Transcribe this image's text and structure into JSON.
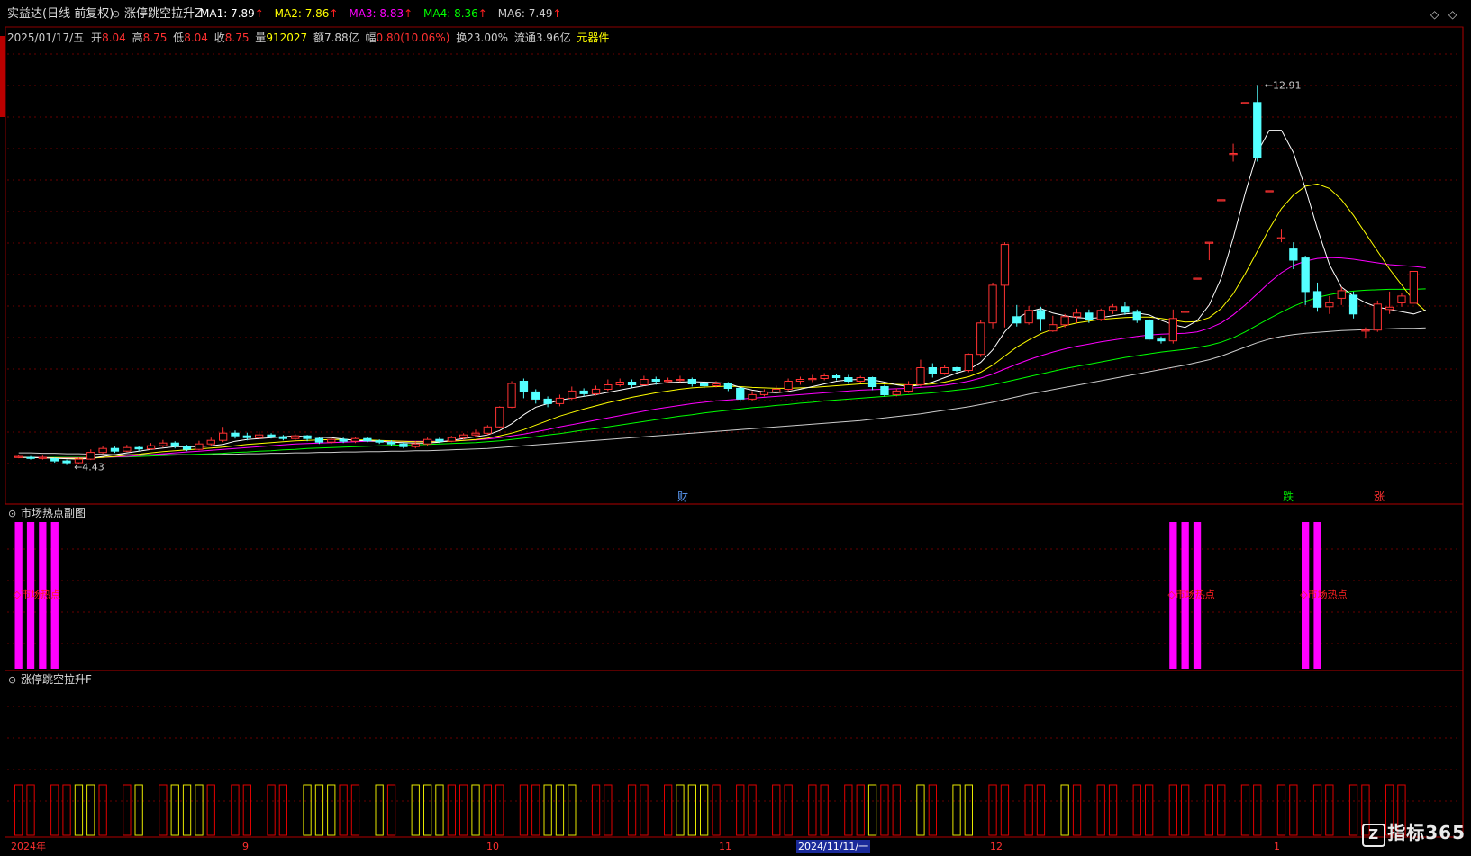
{
  "header": {
    "stock_name": "实益达",
    "period": "(日线 前复权)",
    "indicator_name": "涨停跳空拉升Z",
    "ma": [
      {
        "label": "MA1: 7.89",
        "arrow": "↑",
        "color": "#ffffff"
      },
      {
        "label": "MA2: 7.86",
        "arrow": "↑",
        "color": "#ffff00"
      },
      {
        "label": "MA3: 8.83",
        "arrow": "↑",
        "color": "#ff00ff"
      },
      {
        "label": "MA4: 8.36",
        "arrow": "↑",
        "color": "#00ff00"
      },
      {
        "label": "MA6: 7.49",
        "arrow": "↑",
        "color": "#cccccc"
      }
    ]
  },
  "info": {
    "date": "2025/01/17/五",
    "open_label": "开",
    "open": "8.04",
    "high_label": "高",
    "high": "8.75",
    "low_label": "低",
    "low": "8.04",
    "close_label": "收",
    "close": "8.75",
    "vol_label": "量",
    "vol": "912027",
    "amount_label": "额",
    "amount": "7.88亿",
    "change_label": "幅",
    "change": "0.80(10.06%)",
    "turnover_label": "换",
    "turnover": "23.00%",
    "float_label": "流通",
    "float": "3.96亿",
    "sector": "元器件"
  },
  "price_labels": {
    "high": "12.91",
    "low": "4.43"
  },
  "event_markers": [
    {
      "text": "财",
      "color": "#5fa0ff"
    },
    {
      "text": "跌",
      "color": "#00e000"
    },
    {
      "text": "涨",
      "color": "#ff3030"
    }
  ],
  "panels": {
    "hot": {
      "title": "市场热点副图",
      "signal_text": "市场热点"
    },
    "gap": {
      "title": "涨停跳空拉升F"
    }
  },
  "axis": {
    "dates": [
      {
        "text": "2024年",
        "highlight": false
      },
      {
        "text": "9",
        "highlight": false
      },
      {
        "text": "10",
        "highlight": false
      },
      {
        "text": "11",
        "highlight": false
      },
      {
        "text": "2024/11/11/一",
        "highlight": true
      },
      {
        "text": "12",
        "highlight": false
      },
      {
        "text": "1",
        "highlight": false
      }
    ]
  },
  "watermark": "指标365",
  "colors": {
    "up": "#ff3232",
    "down": "#54ffff",
    "grid": "#8b0000",
    "hot_bar": "#ff00ff",
    "gap_red": "#e00000",
    "gap_yellow": "#e8e800",
    "gap_blue": "#2020ff"
  },
  "chart_data": {
    "type": "candlestick",
    "candles": [
      [
        4.61,
        4.62,
        4.58,
        4.65
      ],
      [
        4.6,
        4.58,
        4.55,
        4.63
      ],
      [
        4.58,
        4.6,
        4.55,
        4.64
      ],
      [
        4.57,
        4.52,
        4.48,
        4.6
      ],
      [
        4.52,
        4.48,
        4.43,
        4.55
      ],
      [
        4.48,
        4.56,
        4.45,
        4.6
      ],
      [
        4.56,
        4.71,
        4.54,
        4.78
      ],
      [
        4.71,
        4.8,
        4.68,
        4.86
      ],
      [
        4.8,
        4.74,
        4.7,
        4.84
      ],
      [
        4.74,
        4.82,
        4.72,
        4.88
      ],
      [
        4.82,
        4.79,
        4.74,
        4.86
      ],
      [
        4.79,
        4.86,
        4.77,
        4.92
      ],
      [
        4.86,
        4.92,
        4.82,
        4.99
      ],
      [
        4.92,
        4.85,
        4.8,
        4.96
      ],
      [
        4.85,
        4.78,
        4.74,
        4.88
      ],
      [
        4.78,
        4.9,
        4.76,
        4.97
      ],
      [
        4.9,
        4.98,
        4.86,
        5.04
      ],
      [
        4.98,
        5.14,
        4.94,
        5.28
      ],
      [
        5.14,
        5.08,
        5.02,
        5.2
      ],
      [
        5.08,
        5.04,
        4.98,
        5.15
      ],
      [
        5.04,
        5.1,
        5.0,
        5.18
      ],
      [
        5.1,
        5.06,
        5.02,
        5.14
      ],
      [
        5.06,
        5.02,
        4.98,
        5.1
      ],
      [
        5.02,
        5.08,
        4.98,
        5.12
      ],
      [
        5.08,
        5.02,
        4.96,
        5.1
      ],
      [
        5.02,
        4.94,
        4.9,
        5.06
      ],
      [
        4.94,
        5.0,
        4.9,
        5.04
      ],
      [
        5.0,
        4.96,
        4.92,
        5.04
      ],
      [
        4.96,
        5.02,
        4.92,
        5.06
      ],
      [
        5.02,
        4.97,
        4.94,
        5.06
      ],
      [
        4.97,
        4.94,
        4.9,
        5.0
      ],
      [
        4.94,
        4.9,
        4.86,
        4.98
      ],
      [
        4.9,
        4.84,
        4.8,
        4.94
      ],
      [
        4.84,
        4.9,
        4.8,
        4.96
      ],
      [
        4.9,
        5.0,
        4.86,
        5.04
      ],
      [
        5.0,
        4.96,
        4.92,
        5.04
      ],
      [
        4.96,
        5.04,
        4.94,
        5.08
      ],
      [
        5.04,
        5.1,
        5.0,
        5.14
      ],
      [
        5.1,
        5.14,
        5.06,
        5.22
      ],
      [
        5.14,
        5.28,
        5.1,
        5.32
      ],
      [
        5.28,
        5.72,
        5.26,
        5.74
      ],
      [
        5.72,
        6.25,
        5.7,
        6.3
      ],
      [
        6.3,
        6.06,
        5.92,
        6.36
      ],
      [
        6.06,
        5.9,
        5.8,
        6.12
      ],
      [
        5.9,
        5.8,
        5.72,
        5.96
      ],
      [
        5.8,
        5.92,
        5.74,
        6.0
      ],
      [
        5.92,
        6.08,
        5.88,
        6.18
      ],
      [
        6.08,
        6.02,
        5.96,
        6.14
      ],
      [
        6.02,
        6.12,
        5.98,
        6.2
      ],
      [
        6.12,
        6.22,
        6.08,
        6.34
      ],
      [
        6.22,
        6.28,
        6.18,
        6.36
      ],
      [
        6.28,
        6.22,
        6.16,
        6.34
      ],
      [
        6.22,
        6.34,
        6.2,
        6.42
      ],
      [
        6.34,
        6.3,
        6.22,
        6.4
      ],
      [
        6.3,
        6.32,
        6.26,
        6.38
      ],
      [
        6.32,
        6.34,
        6.28,
        6.42
      ],
      [
        6.34,
        6.24,
        6.18,
        6.38
      ],
      [
        6.24,
        6.2,
        6.14,
        6.3
      ],
      [
        6.2,
        6.24,
        6.16,
        6.3
      ],
      [
        6.24,
        6.14,
        6.08,
        6.28
      ],
      [
        6.14,
        5.9,
        5.84,
        6.18
      ],
      [
        5.9,
        6.0,
        5.86,
        6.08
      ],
      [
        6.0,
        6.06,
        5.96,
        6.12
      ],
      [
        6.06,
        6.12,
        6.02,
        6.2
      ],
      [
        6.12,
        6.3,
        6.08,
        6.36
      ],
      [
        6.3,
        6.34,
        6.22,
        6.4
      ],
      [
        6.34,
        6.36,
        6.28,
        6.44
      ],
      [
        6.36,
        6.42,
        6.32,
        6.48
      ],
      [
        6.42,
        6.38,
        6.32,
        6.46
      ],
      [
        6.38,
        6.3,
        6.24,
        6.44
      ],
      [
        6.3,
        6.38,
        6.26,
        6.42
      ],
      [
        6.38,
        6.18,
        6.1,
        6.4
      ],
      [
        6.18,
        6.0,
        5.96,
        6.22
      ],
      [
        6.0,
        6.08,
        5.96,
        6.14
      ],
      [
        6.08,
        6.22,
        6.04,
        6.3
      ],
      [
        6.22,
        6.6,
        6.18,
        6.78
      ],
      [
        6.6,
        6.48,
        6.38,
        6.7
      ],
      [
        6.48,
        6.6,
        6.44,
        6.66
      ],
      [
        6.6,
        6.54,
        6.5,
        6.62
      ],
      [
        6.54,
        6.9,
        6.5,
        6.92
      ],
      [
        6.9,
        7.6,
        6.84,
        7.66
      ],
      [
        7.6,
        8.44,
        7.48,
        8.5
      ],
      [
        8.44,
        9.35,
        7.5,
        9.4
      ],
      [
        7.74,
        7.6,
        7.52,
        8.0
      ],
      [
        7.6,
        7.88,
        7.56,
        7.98
      ],
      [
        7.88,
        7.7,
        7.42,
        7.96
      ],
      [
        7.42,
        7.56,
        7.4,
        7.76
      ],
      [
        7.56,
        7.74,
        7.5,
        7.8
      ],
      [
        7.74,
        7.82,
        7.6,
        7.92
      ],
      [
        7.82,
        7.68,
        7.6,
        7.9
      ],
      [
        7.68,
        7.88,
        7.64,
        7.92
      ],
      [
        7.88,
        7.96,
        7.8,
        8.02
      ],
      [
        7.96,
        7.84,
        7.78,
        8.06
      ],
      [
        7.84,
        7.66,
        7.6,
        7.9
      ],
      [
        7.66,
        7.24,
        7.2,
        7.7
      ],
      [
        7.24,
        7.2,
        7.14,
        7.3
      ],
      [
        7.2,
        7.7,
        7.14,
        7.9
      ],
      [
        7.86,
        7.86,
        7.86,
        7.86
      ],
      [
        8.6,
        8.6,
        8.6,
        8.6
      ],
      [
        9.4,
        9.4,
        9.0,
        9.4
      ],
      [
        10.35,
        10.35,
        10.35,
        10.35
      ],
      [
        11.38,
        11.38,
        11.2,
        11.6
      ],
      [
        12.52,
        12.52,
        12.52,
        12.52
      ],
      [
        12.52,
        11.3,
        11.2,
        12.91
      ],
      [
        10.55,
        10.55,
        10.55,
        10.55
      ],
      [
        9.5,
        9.5,
        9.4,
        9.7
      ],
      [
        9.25,
        9.0,
        8.8,
        9.4
      ],
      [
        9.05,
        8.3,
        8.0,
        9.1
      ],
      [
        8.3,
        7.95,
        7.85,
        8.5
      ],
      [
        7.96,
        8.05,
        7.8,
        8.2
      ],
      [
        8.15,
        8.32,
        8.0,
        8.4
      ],
      [
        8.22,
        7.8,
        7.7,
        8.3
      ],
      [
        7.42,
        7.44,
        7.25,
        7.5
      ],
      [
        7.44,
        8.02,
        7.4,
        8.1
      ],
      [
        7.9,
        7.95,
        7.8,
        8.3
      ],
      [
        8.05,
        8.2,
        7.96,
        8.26
      ],
      [
        8.04,
        8.75,
        8.04,
        8.75
      ]
    ],
    "ma1": [
      4.6,
      4.6,
      4.59,
      4.58,
      4.57,
      4.56,
      4.58,
      4.62,
      4.66,
      4.7,
      4.74,
      4.78,
      4.81,
      4.84,
      4.84,
      4.84,
      4.86,
      4.89,
      4.96,
      5.0,
      5.02,
      5.04,
      5.06,
      5.08,
      5.06,
      5.05,
      5.04,
      5.01,
      4.98,
      4.97,
      4.96,
      4.94,
      4.93,
      4.92,
      4.92,
      4.94,
      4.98,
      5.02,
      5.06,
      5.1,
      5.2,
      5.35,
      5.55,
      5.72,
      5.8,
      5.88,
      5.92,
      5.96,
      6.0,
      6.05,
      6.1,
      6.15,
      6.2,
      6.24,
      6.27,
      6.28,
      6.29,
      6.28,
      6.27,
      6.25,
      6.16,
      6.1,
      6.06,
      6.04,
      6.07,
      6.12,
      6.18,
      6.24,
      6.3,
      6.33,
      6.34,
      6.33,
      6.28,
      6.22,
      6.18,
      6.22,
      6.28,
      6.38,
      6.48,
      6.56,
      6.72,
      7.0,
      7.4,
      7.7,
      7.85,
      7.92,
      7.82,
      7.76,
      7.72,
      7.7,
      7.72,
      7.76,
      7.8,
      7.82,
      7.78,
      7.66,
      7.56,
      7.5,
      7.65,
      8.0,
      8.6,
      9.5,
      10.5,
      11.4,
      11.9,
      11.9,
      11.4,
      10.6,
      9.7,
      8.9,
      8.4,
      8.2,
      8.05,
      7.95,
      7.9,
      7.85,
      7.8,
      7.89
    ],
    "ma2": [
      4.6,
      4.6,
      4.59,
      4.59,
      4.58,
      4.58,
      4.58,
      4.6,
      4.62,
      4.65,
      4.67,
      4.7,
      4.73,
      4.75,
      4.77,
      4.79,
      4.81,
      4.83,
      4.86,
      4.89,
      4.91,
      4.93,
      4.95,
      4.97,
      4.98,
      4.99,
      5.0,
      5.0,
      4.99,
      4.99,
      4.98,
      4.97,
      4.96,
      4.95,
      4.95,
      4.95,
      4.96,
      4.98,
      5.0,
      5.03,
      5.08,
      5.14,
      5.22,
      5.32,
      5.42,
      5.52,
      5.6,
      5.68,
      5.75,
      5.82,
      5.88,
      5.94,
      5.99,
      6.04,
      6.08,
      6.12,
      6.15,
      6.17,
      6.18,
      6.19,
      6.18,
      6.16,
      6.15,
      6.14,
      6.14,
      6.15,
      6.16,
      6.18,
      6.2,
      6.22,
      6.24,
      6.25,
      6.24,
      6.23,
      6.22,
      6.22,
      6.24,
      6.28,
      6.34,
      6.4,
      6.5,
      6.66,
      6.86,
      7.06,
      7.22,
      7.36,
      7.46,
      7.54,
      7.6,
      7.64,
      7.68,
      7.7,
      7.72,
      7.73,
      7.73,
      7.7,
      7.66,
      7.62,
      7.63,
      7.72,
      7.92,
      8.25,
      8.7,
      9.2,
      9.7,
      10.15,
      10.45,
      10.65,
      10.7,
      10.6,
      10.35,
      10.0,
      9.6,
      9.2,
      8.8,
      8.45,
      8.1,
      7.86
    ],
    "ma3": [
      4.6,
      4.6,
      4.6,
      4.59,
      4.59,
      4.59,
      4.59,
      4.6,
      4.61,
      4.62,
      4.64,
      4.66,
      4.68,
      4.7,
      4.72,
      4.74,
      4.76,
      4.78,
      4.8,
      4.82,
      4.84,
      4.86,
      4.88,
      4.9,
      4.91,
      4.92,
      4.93,
      4.94,
      4.95,
      4.96,
      4.96,
      4.96,
      4.96,
      4.96,
      4.96,
      4.96,
      4.97,
      4.98,
      4.99,
      5.01,
      5.04,
      5.08,
      5.12,
      5.17,
      5.22,
      5.28,
      5.33,
      5.38,
      5.43,
      5.48,
      5.53,
      5.58,
      5.63,
      5.68,
      5.72,
      5.76,
      5.8,
      5.83,
      5.86,
      5.88,
      5.9,
      5.92,
      5.94,
      5.96,
      5.98,
      6.0,
      6.02,
      6.04,
      6.06,
      6.08,
      6.1,
      6.11,
      6.12,
      6.13,
      6.14,
      6.16,
      6.18,
      6.21,
      6.25,
      6.3,
      6.37,
      6.46,
      6.57,
      6.68,
      6.78,
      6.87,
      6.95,
      7.02,
      7.08,
      7.13,
      7.18,
      7.22,
      7.26,
      7.3,
      7.33,
      7.35,
      7.36,
      7.37,
      7.4,
      7.48,
      7.6,
      7.78,
      8.0,
      8.25,
      8.5,
      8.72,
      8.88,
      8.98,
      9.04,
      9.06,
      9.05,
      9.02,
      8.98,
      8.94,
      8.9,
      8.88,
      8.86,
      8.83
    ],
    "ma4": [
      4.6,
      4.6,
      4.6,
      4.6,
      4.6,
      4.6,
      4.6,
      4.6,
      4.61,
      4.61,
      4.62,
      4.63,
      4.64,
      4.65,
      4.66,
      4.67,
      4.68,
      4.69,
      4.71,
      4.72,
      4.74,
      4.75,
      4.77,
      4.78,
      4.8,
      4.81,
      4.82,
      4.83,
      4.84,
      4.85,
      4.86,
      4.87,
      4.88,
      4.88,
      4.89,
      4.9,
      4.91,
      4.92,
      4.93,
      4.95,
      4.97,
      5.0,
      5.03,
      5.06,
      5.1,
      5.13,
      5.17,
      5.21,
      5.24,
      5.28,
      5.32,
      5.36,
      5.4,
      5.44,
      5.48,
      5.52,
      5.55,
      5.59,
      5.62,
      5.65,
      5.68,
      5.71,
      5.73,
      5.76,
      5.78,
      5.81,
      5.83,
      5.86,
      5.88,
      5.9,
      5.92,
      5.94,
      5.96,
      5.98,
      6.0,
      6.02,
      6.04,
      6.07,
      6.1,
      6.13,
      6.17,
      6.22,
      6.28,
      6.34,
      6.4,
      6.46,
      6.52,
      6.58,
      6.63,
      6.68,
      6.73,
      6.78,
      6.83,
      6.87,
      6.91,
      6.95,
      6.98,
      7.01,
      7.05,
      7.1,
      7.17,
      7.27,
      7.4,
      7.55,
      7.7,
      7.84,
      7.97,
      8.08,
      8.17,
      8.23,
      8.28,
      8.31,
      8.33,
      8.34,
      8.35,
      8.35,
      8.35,
      8.36
    ],
    "ma6": [
      4.7,
      4.7,
      4.69,
      4.69,
      4.68,
      4.68,
      4.67,
      4.67,
      4.66,
      4.66,
      4.66,
      4.66,
      4.66,
      4.66,
      4.66,
      4.66,
      4.66,
      4.67,
      4.67,
      4.68,
      4.68,
      4.69,
      4.69,
      4.7,
      4.7,
      4.71,
      4.71,
      4.72,
      4.72,
      4.73,
      4.73,
      4.74,
      4.74,
      4.75,
      4.75,
      4.76,
      4.77,
      4.78,
      4.79,
      4.8,
      4.82,
      4.84,
      4.86,
      4.88,
      4.9,
      4.92,
      4.94,
      4.96,
      4.98,
      5.0,
      5.02,
      5.04,
      5.06,
      5.08,
      5.1,
      5.12,
      5.14,
      5.16,
      5.18,
      5.2,
      5.22,
      5.24,
      5.26,
      5.28,
      5.3,
      5.32,
      5.34,
      5.36,
      5.38,
      5.4,
      5.42,
      5.45,
      5.48,
      5.51,
      5.54,
      5.57,
      5.61,
      5.65,
      5.69,
      5.73,
      5.78,
      5.83,
      5.89,
      5.95,
      6.01,
      6.06,
      6.11,
      6.16,
      6.21,
      6.26,
      6.31,
      6.36,
      6.41,
      6.46,
      6.51,
      6.56,
      6.61,
      6.66,
      6.72,
      6.78,
      6.86,
      6.96,
      7.06,
      7.16,
      7.24,
      7.3,
      7.34,
      7.37,
      7.39,
      7.41,
      7.43,
      7.44,
      7.45,
      7.46,
      7.47,
      7.48,
      7.48,
      7.49
    ],
    "y_range": [
      4.0,
      13.6
    ],
    "hot_signals": [
      {
        "from": 0,
        "to": 3
      },
      {
        "from": 96,
        "to": 98
      },
      {
        "from": 107,
        "to": 108
      }
    ],
    "hot_level": 0.85,
    "gap_bars": "RRRRRYYRRRYRRYYYRRRRRRRRYYYRRRYRRYYYRRYRRRRRYYYRRRRRRRRYYYRRRRRRRRRRRRRYRRRYRRYYRRRRRRRYRRRRRRRRRRRRRRRRRRRRRRRRRRRRR"
  }
}
